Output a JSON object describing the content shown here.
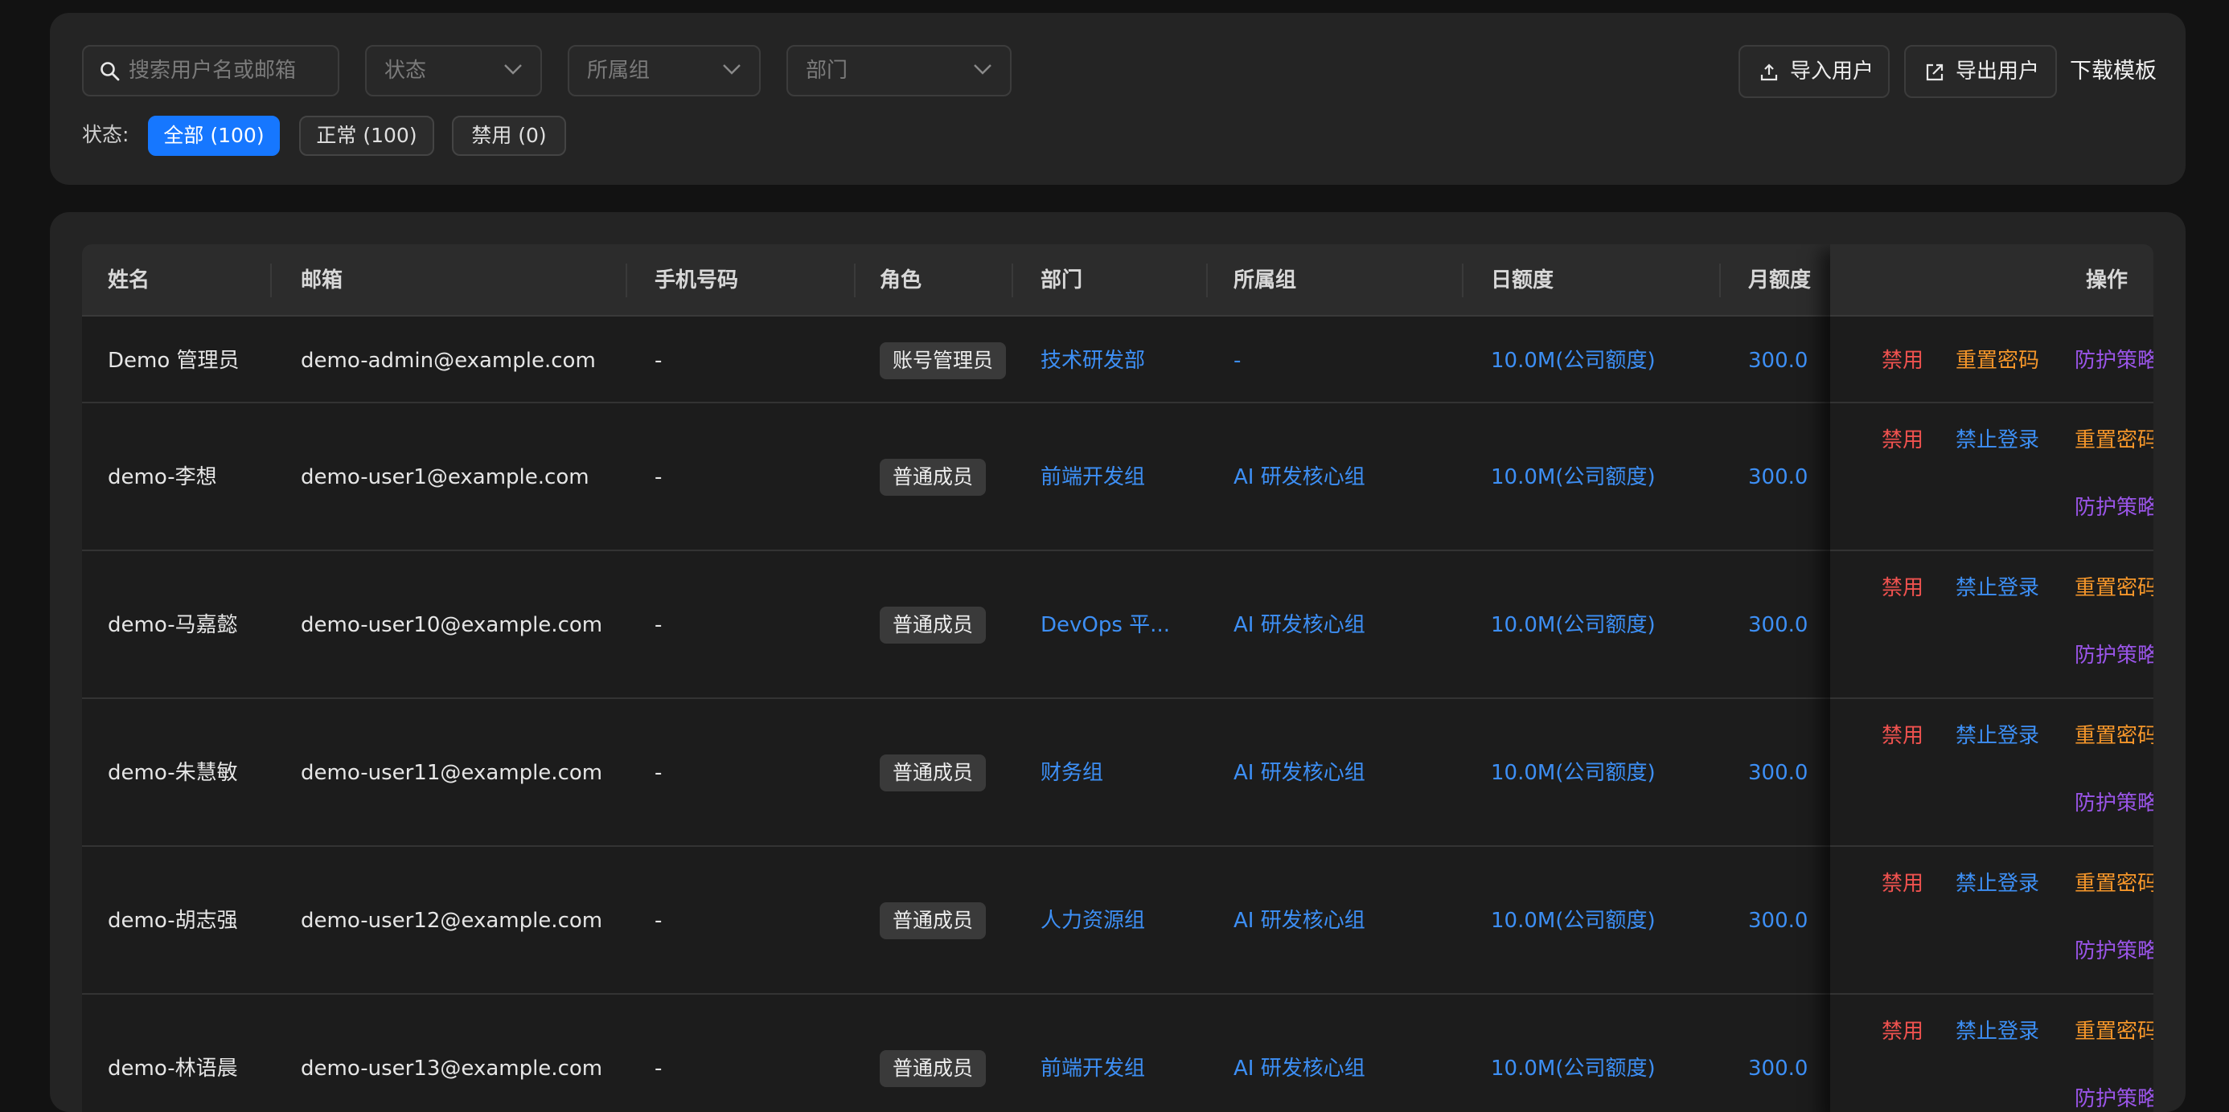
{
  "filters": {
    "search_placeholder": "搜索用户名或邮箱",
    "status_placeholder": "状态",
    "group_placeholder": "所属组",
    "dept_placeholder": "部门",
    "import_label": "导入用户",
    "export_label": "导出用户",
    "download_template_label": "下载模板",
    "status_label": "状态:",
    "chips": [
      {
        "label": "全部 (100)",
        "active": true
      },
      {
        "label": "正常 (100)",
        "active": false
      },
      {
        "label": "禁用 (0)",
        "active": false
      }
    ]
  },
  "table": {
    "headers": {
      "name": "姓名",
      "email": "邮箱",
      "phone": "手机号码",
      "role": "角色",
      "dept": "部门",
      "group": "所属组",
      "daily": "日额度",
      "monthly": "月额度",
      "actions": "操作"
    },
    "rows": [
      {
        "name": "Demo 管理员",
        "email": "demo-admin@example.com",
        "phone": "-",
        "role": "账号管理员",
        "dept": "技术研发部",
        "group": "-",
        "daily": "10.0M(公司额度)",
        "monthly": "300.0",
        "actions": [
          "禁用",
          "重置密码",
          "防护策略"
        ]
      },
      {
        "name": "demo-李想",
        "email": "demo-user1@example.com",
        "phone": "-",
        "role": "普通成员",
        "dept": "前端开发组",
        "group": "AI 研发核心组",
        "daily": "10.0M(公司额度)",
        "monthly": "300.0",
        "actions": [
          "禁用",
          "禁止登录",
          "重置密码",
          "防护策略"
        ]
      },
      {
        "name": "demo-马嘉懿",
        "email": "demo-user10@example.com",
        "phone": "-",
        "role": "普通成员",
        "dept": "DevOps 平...",
        "group": "AI 研发核心组",
        "daily": "10.0M(公司额度)",
        "monthly": "300.0",
        "actions": [
          "禁用",
          "禁止登录",
          "重置密码",
          "防护策略"
        ]
      },
      {
        "name": "demo-朱慧敏",
        "email": "demo-user11@example.com",
        "phone": "-",
        "role": "普通成员",
        "dept": "财务组",
        "group": "AI 研发核心组",
        "daily": "10.0M(公司额度)",
        "monthly": "300.0",
        "actions": [
          "禁用",
          "禁止登录",
          "重置密码",
          "防护策略"
        ]
      },
      {
        "name": "demo-胡志强",
        "email": "demo-user12@example.com",
        "phone": "-",
        "role": "普通成员",
        "dept": "人力资源组",
        "group": "AI 研发核心组",
        "daily": "10.0M(公司额度)",
        "monthly": "300.0",
        "actions": [
          "禁用",
          "禁止登录",
          "重置密码",
          "防护策略"
        ]
      },
      {
        "name": "demo-林语晨",
        "email": "demo-user13@example.com",
        "phone": "-",
        "role": "普通成员",
        "dept": "前端开发组",
        "group": "AI 研发核心组",
        "daily": "10.0M(公司额度)",
        "monthly": "300.0",
        "actions": [
          "禁用",
          "禁止登录",
          "重置密码",
          "防护策略"
        ]
      }
    ]
  }
}
